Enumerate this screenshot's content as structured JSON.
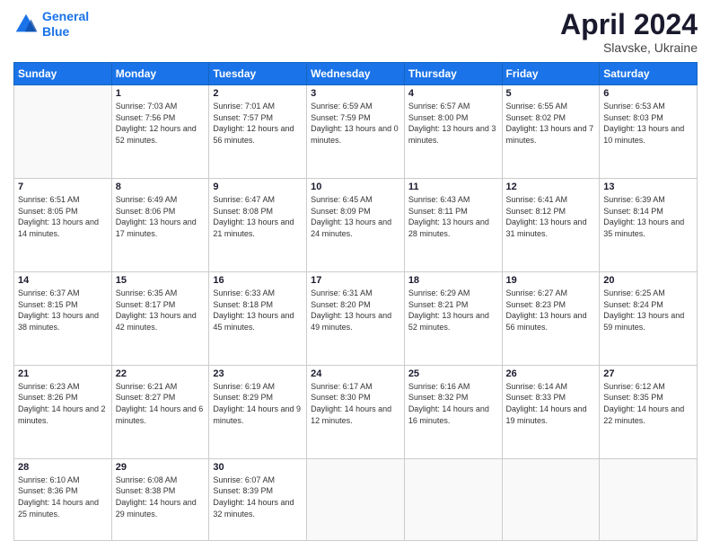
{
  "header": {
    "logo_line1": "General",
    "logo_line2": "Blue",
    "month": "April 2024",
    "location": "Slavske, Ukraine"
  },
  "days_of_week": [
    "Sunday",
    "Monday",
    "Tuesday",
    "Wednesday",
    "Thursday",
    "Friday",
    "Saturday"
  ],
  "weeks": [
    [
      {
        "num": "",
        "empty": true
      },
      {
        "num": "1",
        "sunrise": "Sunrise: 7:03 AM",
        "sunset": "Sunset: 7:56 PM",
        "daylight": "Daylight: 12 hours and 52 minutes."
      },
      {
        "num": "2",
        "sunrise": "Sunrise: 7:01 AM",
        "sunset": "Sunset: 7:57 PM",
        "daylight": "Daylight: 12 hours and 56 minutes."
      },
      {
        "num": "3",
        "sunrise": "Sunrise: 6:59 AM",
        "sunset": "Sunset: 7:59 PM",
        "daylight": "Daylight: 13 hours and 0 minutes."
      },
      {
        "num": "4",
        "sunrise": "Sunrise: 6:57 AM",
        "sunset": "Sunset: 8:00 PM",
        "daylight": "Daylight: 13 hours and 3 minutes."
      },
      {
        "num": "5",
        "sunrise": "Sunrise: 6:55 AM",
        "sunset": "Sunset: 8:02 PM",
        "daylight": "Daylight: 13 hours and 7 minutes."
      },
      {
        "num": "6",
        "sunrise": "Sunrise: 6:53 AM",
        "sunset": "Sunset: 8:03 PM",
        "daylight": "Daylight: 13 hours and 10 minutes."
      }
    ],
    [
      {
        "num": "7",
        "sunrise": "Sunrise: 6:51 AM",
        "sunset": "Sunset: 8:05 PM",
        "daylight": "Daylight: 13 hours and 14 minutes."
      },
      {
        "num": "8",
        "sunrise": "Sunrise: 6:49 AM",
        "sunset": "Sunset: 8:06 PM",
        "daylight": "Daylight: 13 hours and 17 minutes."
      },
      {
        "num": "9",
        "sunrise": "Sunrise: 6:47 AM",
        "sunset": "Sunset: 8:08 PM",
        "daylight": "Daylight: 13 hours and 21 minutes."
      },
      {
        "num": "10",
        "sunrise": "Sunrise: 6:45 AM",
        "sunset": "Sunset: 8:09 PM",
        "daylight": "Daylight: 13 hours and 24 minutes."
      },
      {
        "num": "11",
        "sunrise": "Sunrise: 6:43 AM",
        "sunset": "Sunset: 8:11 PM",
        "daylight": "Daylight: 13 hours and 28 minutes."
      },
      {
        "num": "12",
        "sunrise": "Sunrise: 6:41 AM",
        "sunset": "Sunset: 8:12 PM",
        "daylight": "Daylight: 13 hours and 31 minutes."
      },
      {
        "num": "13",
        "sunrise": "Sunrise: 6:39 AM",
        "sunset": "Sunset: 8:14 PM",
        "daylight": "Daylight: 13 hours and 35 minutes."
      }
    ],
    [
      {
        "num": "14",
        "sunrise": "Sunrise: 6:37 AM",
        "sunset": "Sunset: 8:15 PM",
        "daylight": "Daylight: 13 hours and 38 minutes."
      },
      {
        "num": "15",
        "sunrise": "Sunrise: 6:35 AM",
        "sunset": "Sunset: 8:17 PM",
        "daylight": "Daylight: 13 hours and 42 minutes."
      },
      {
        "num": "16",
        "sunrise": "Sunrise: 6:33 AM",
        "sunset": "Sunset: 8:18 PM",
        "daylight": "Daylight: 13 hours and 45 minutes."
      },
      {
        "num": "17",
        "sunrise": "Sunrise: 6:31 AM",
        "sunset": "Sunset: 8:20 PM",
        "daylight": "Daylight: 13 hours and 49 minutes."
      },
      {
        "num": "18",
        "sunrise": "Sunrise: 6:29 AM",
        "sunset": "Sunset: 8:21 PM",
        "daylight": "Daylight: 13 hours and 52 minutes."
      },
      {
        "num": "19",
        "sunrise": "Sunrise: 6:27 AM",
        "sunset": "Sunset: 8:23 PM",
        "daylight": "Daylight: 13 hours and 56 minutes."
      },
      {
        "num": "20",
        "sunrise": "Sunrise: 6:25 AM",
        "sunset": "Sunset: 8:24 PM",
        "daylight": "Daylight: 13 hours and 59 minutes."
      }
    ],
    [
      {
        "num": "21",
        "sunrise": "Sunrise: 6:23 AM",
        "sunset": "Sunset: 8:26 PM",
        "daylight": "Daylight: 14 hours and 2 minutes."
      },
      {
        "num": "22",
        "sunrise": "Sunrise: 6:21 AM",
        "sunset": "Sunset: 8:27 PM",
        "daylight": "Daylight: 14 hours and 6 minutes."
      },
      {
        "num": "23",
        "sunrise": "Sunrise: 6:19 AM",
        "sunset": "Sunset: 8:29 PM",
        "daylight": "Daylight: 14 hours and 9 minutes."
      },
      {
        "num": "24",
        "sunrise": "Sunrise: 6:17 AM",
        "sunset": "Sunset: 8:30 PM",
        "daylight": "Daylight: 14 hours and 12 minutes."
      },
      {
        "num": "25",
        "sunrise": "Sunrise: 6:16 AM",
        "sunset": "Sunset: 8:32 PM",
        "daylight": "Daylight: 14 hours and 16 minutes."
      },
      {
        "num": "26",
        "sunrise": "Sunrise: 6:14 AM",
        "sunset": "Sunset: 8:33 PM",
        "daylight": "Daylight: 14 hours and 19 minutes."
      },
      {
        "num": "27",
        "sunrise": "Sunrise: 6:12 AM",
        "sunset": "Sunset: 8:35 PM",
        "daylight": "Daylight: 14 hours and 22 minutes."
      }
    ],
    [
      {
        "num": "28",
        "sunrise": "Sunrise: 6:10 AM",
        "sunset": "Sunset: 8:36 PM",
        "daylight": "Daylight: 14 hours and 25 minutes."
      },
      {
        "num": "29",
        "sunrise": "Sunrise: 6:08 AM",
        "sunset": "Sunset: 8:38 PM",
        "daylight": "Daylight: 14 hours and 29 minutes."
      },
      {
        "num": "30",
        "sunrise": "Sunrise: 6:07 AM",
        "sunset": "Sunset: 8:39 PM",
        "daylight": "Daylight: 14 hours and 32 minutes."
      },
      {
        "num": "",
        "empty": true
      },
      {
        "num": "",
        "empty": true
      },
      {
        "num": "",
        "empty": true
      },
      {
        "num": "",
        "empty": true
      }
    ]
  ]
}
